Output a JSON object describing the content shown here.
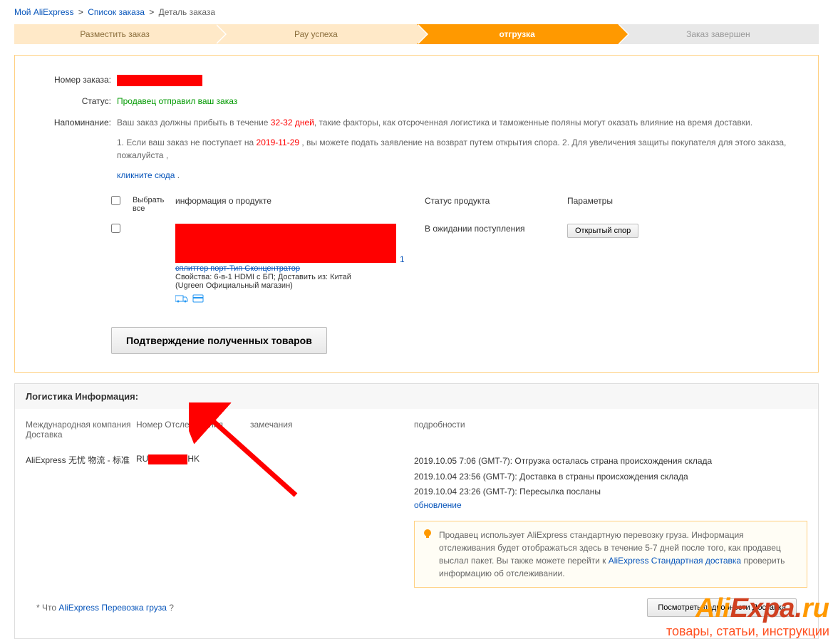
{
  "breadcrumb": {
    "my_ali": "Мой AliExpress",
    "order_list": "Список заказа",
    "order_detail": "Деталь заказа"
  },
  "steps": {
    "s1": "Разместить заказ",
    "s2": "Рау успеха",
    "s3": "отгрузка",
    "s4": "Заказ завершен"
  },
  "order": {
    "number_label": "Номер заказа:",
    "status_label": "Статус:",
    "status_value": "Продавец отправил ваш заказ",
    "reminder_label": "Напоминание:",
    "reminder_text_1a": "Ваш заказ должны прибыть в течение ",
    "reminder_days": "32-32 дней",
    "reminder_text_1b": ", такие факторы, как отсроченная логистика и таможенные поляны могут оказать влияние на время доставки.",
    "reminder_text_2a": "1. Если ваш заказ не поступает на ",
    "reminder_date": "2019-11-29",
    "reminder_text_2b": " , вы можете подать заявление на возврат путем открытия спора. 2. Для увеличения защиты покупателя для этого заказа, пожалуйста ,",
    "click_here": "кликните сюда",
    "dot": " ."
  },
  "table": {
    "select_all": "Выбрать все",
    "col_info": "информация о продукте",
    "col_status": "Статус продукта",
    "col_params": "Параметры"
  },
  "product": {
    "crossed": "сплиттер порт-Тип Сконцентратор",
    "num1": "1",
    "props": "Свойства: 6-в-1 HDMI с БП; Доставить из: Китай",
    "store": "(Ugreen Официальный магазин)",
    "status": "В ожидании поступления",
    "dispute_btn": "Открытый спор"
  },
  "confirm_btn": "Подтверждение полученных товаров",
  "logistics": {
    "title": "Логистика Информация:",
    "col_company": "Международная компания Доставка",
    "col_track": "Номер Отслеживания",
    "col_notes": "замечания",
    "col_details": "подробности",
    "company": "AliExpress 无忧 物流 - 标准",
    "track_prefix": "RU",
    "track_suffix": "HK",
    "events": [
      "2019.10.05 7:06 (GMT-7): Отгрузка осталась страна происхождения склада",
      "2019.10.04 23:56 (GMT-7): Доставка в страны происхождения склада",
      "2019.10.04 23:26 (GMT-7): Пересылка посланы"
    ],
    "update": "обновление",
    "info_1": "Продавец использует AliExpress стандартную перевозку груза. Информация отслеживания будет отображаться здесь в течение 5-7 дней после того, как продавец выслал пакет. Вы также можете перейти к ",
    "info_link": "AliExpress Стандартная доставка",
    "info_2": " проверить информацию об отслеживании."
  },
  "footer": {
    "what_prefix": "* Что ",
    "what_link": "AliExpress Перевозка груза",
    "what_suffix": " ?",
    "view_btn": "Посмотреть подробности Доставка"
  },
  "watermark": {
    "ali": "Ali",
    "expa": "Expa",
    "dot": ".",
    "ru": "ru",
    "sub": "товары, статьи, инструкции"
  }
}
